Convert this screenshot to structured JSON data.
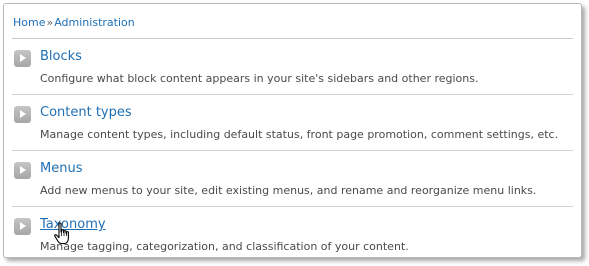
{
  "breadcrumb": {
    "home": "Home",
    "separator": "»",
    "current": "Administration"
  },
  "items": [
    {
      "title": "Blocks",
      "description": "Configure what block content appears in your site's sidebars and other regions."
    },
    {
      "title": "Content types",
      "description": "Manage content types, including default status, front page promotion, comment settings, etc."
    },
    {
      "title": "Menus",
      "description": "Add new menus to your site, edit existing menus, and rename and reorganize menu links."
    },
    {
      "title": "Taxonomy",
      "description": "Manage tagging, categorization, and classification of your content."
    }
  ],
  "colors": {
    "link": "#1f6fb5",
    "text": "#4a4a4a",
    "arrow": "#b0b0b0"
  },
  "cursor": {
    "icon": "hand-pointer-icon",
    "hovered_item": "Taxonomy"
  }
}
